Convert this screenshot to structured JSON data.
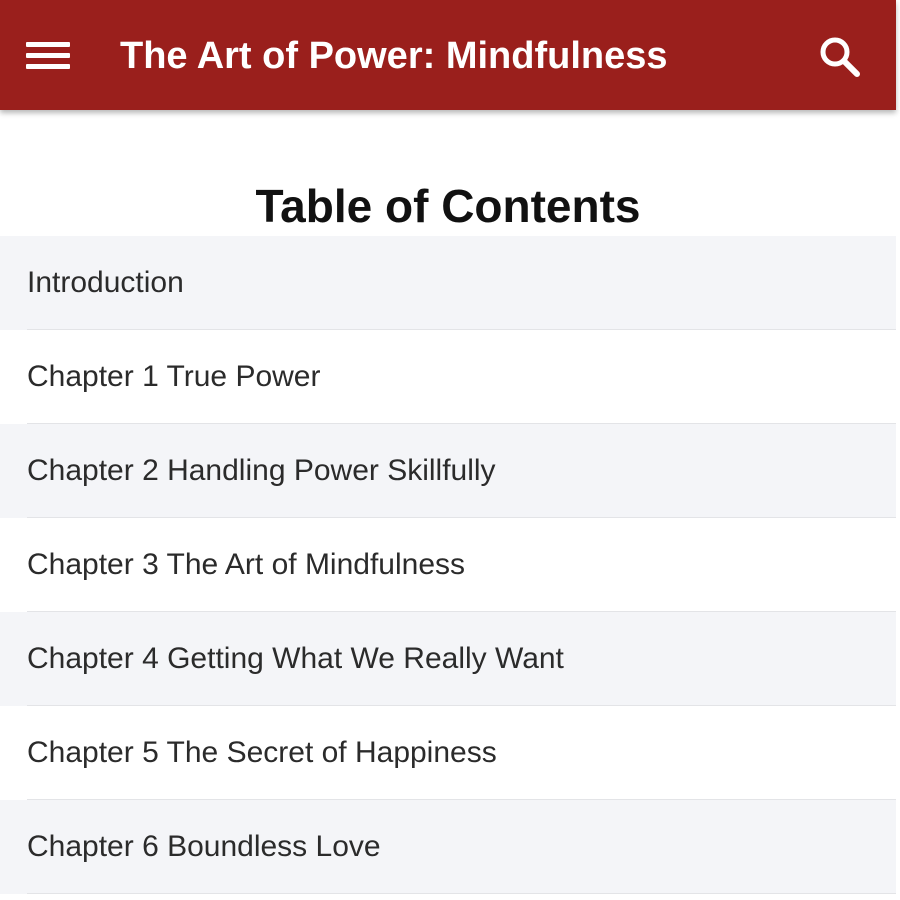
{
  "app_bar": {
    "title": "The Art of Power: Mindfulness",
    "background_color": "#9a1f1c",
    "menu_icon": "hamburger-menu-icon",
    "search_icon": "search-icon"
  },
  "toc": {
    "heading": "Table of Contents",
    "items": [
      {
        "label": "Introduction"
      },
      {
        "label": "Chapter 1 True Power"
      },
      {
        "label": "Chapter 2 Handling Power Skillfully"
      },
      {
        "label": "Chapter 3 The Art of Mindfulness"
      },
      {
        "label": "Chapter 4 Getting What We Really Want"
      },
      {
        "label": "Chapter 5 The Secret of Happiness"
      },
      {
        "label": "Chapter 6 Boundless Love"
      }
    ]
  }
}
